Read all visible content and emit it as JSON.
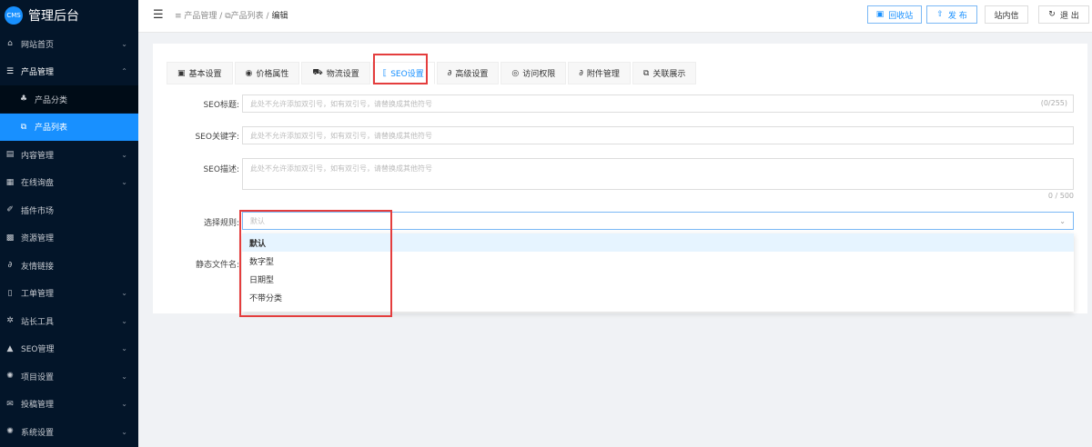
{
  "app": {
    "logo_badge": "CMS",
    "title": "管理后台"
  },
  "sidebar": {
    "items": [
      {
        "label": "网站首页",
        "icon": "home-icon",
        "chev": "⌄"
      },
      {
        "label": "产品管理",
        "icon": "list-icon",
        "chev": "⌃"
      },
      {
        "label": "产品分类",
        "icon": "cubes-icon"
      },
      {
        "label": "产品列表",
        "icon": "copy-icon"
      },
      {
        "label": "内容管理",
        "icon": "newspaper-icon",
        "chev": "⌄"
      },
      {
        "label": "在线询盘",
        "icon": "table-icon",
        "chev": "⌄"
      },
      {
        "label": "插件市场",
        "icon": "pin-icon"
      },
      {
        "label": "资源管理",
        "icon": "grid-icon"
      },
      {
        "label": "友情链接",
        "icon": "link-icon"
      },
      {
        "label": "工单管理",
        "icon": "document-icon",
        "chev": "⌄"
      },
      {
        "label": "站长工具",
        "icon": "gears-icon",
        "chev": "⌄"
      },
      {
        "label": "SEO管理",
        "icon": "warning-icon",
        "chev": "⌄"
      },
      {
        "label": "项目设置",
        "icon": "gear-icon",
        "chev": "⌄"
      },
      {
        "label": "投稿管理",
        "icon": "mail-icon",
        "chev": "⌄"
      },
      {
        "label": "系统设置",
        "icon": "gear-icon",
        "chev": "⌄"
      }
    ]
  },
  "header": {
    "breadcrumb": [
      "产品管理",
      "产品列表",
      "编辑"
    ],
    "sep": "/",
    "buttons": {
      "recycle": "回收站",
      "publish": "发 布",
      "messages": "站内信",
      "logout": "退 出"
    }
  },
  "tabs": [
    "基本设置",
    "价格属性",
    "物流设置",
    "SEO设置",
    "高级设置",
    "访问权限",
    "附件管理",
    "关联展示"
  ],
  "form": {
    "seo_title": {
      "label": "SEO标题:",
      "placeholder": "此处不允许添加双引号，如有双引号，请替换成其他符号",
      "count": "(0/255)"
    },
    "seo_keywords": {
      "label": "SEO关键字:",
      "placeholder": "此处不允许添加双引号，如有双引号，请替换成其他符号"
    },
    "seo_desc": {
      "label": "SEO描述:",
      "placeholder": "此处不允许添加双引号，如有双引号，请替换成其他符号",
      "count": "0 / 500"
    },
    "rule": {
      "label": "选择规则:",
      "placeholder": "默认",
      "options": [
        "默认",
        "数字型",
        "日期型",
        "不带分类"
      ]
    },
    "static_name": {
      "label": "静态文件名:"
    }
  },
  "colors": {
    "accent": "#1890ff",
    "sidebar": "#031529",
    "highlight": "#e43d3d"
  }
}
